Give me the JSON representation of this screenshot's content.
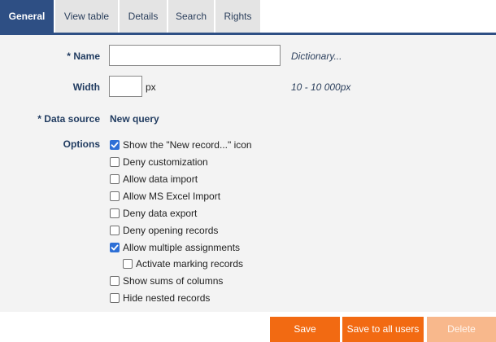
{
  "tabs": [
    {
      "label": "General",
      "active": true
    },
    {
      "label": "View table",
      "active": false
    },
    {
      "label": "Details",
      "active": false
    },
    {
      "label": "Search",
      "active": false
    },
    {
      "label": "Rights",
      "active": false
    }
  ],
  "form": {
    "name": {
      "required_mark": "*",
      "label": "Name",
      "value": "",
      "hint": "Dictionary..."
    },
    "width": {
      "label": "Width",
      "value": "",
      "unit": "px",
      "hint": "10 - 10 000px"
    },
    "data_source": {
      "required_mark": "*",
      "label": "Data source",
      "value": "New query"
    },
    "options": {
      "label": "Options",
      "items": [
        {
          "label": "Show the \"New record...\" icon",
          "checked": true
        },
        {
          "label": "Deny customization",
          "checked": false
        },
        {
          "label": "Allow data import",
          "checked": false
        },
        {
          "label": "Allow MS Excel Import",
          "checked": false
        },
        {
          "label": "Deny data export",
          "checked": false
        },
        {
          "label": "Deny opening records",
          "checked": false
        },
        {
          "label": "Allow multiple assignments",
          "checked": true
        },
        {
          "label": "Activate marking records",
          "checked": false
        },
        {
          "label": "Show sums of columns",
          "checked": false
        },
        {
          "label": "Hide nested records",
          "checked": false
        }
      ]
    }
  },
  "buttons": {
    "save": "Save",
    "save_all": "Save to all users",
    "delete": "Delete"
  },
  "colors": {
    "accent": "#2e4f84",
    "button": "#f26a12",
    "button_disabled": "#f8b88c",
    "checkbox_checked": "#2d6fd6"
  }
}
